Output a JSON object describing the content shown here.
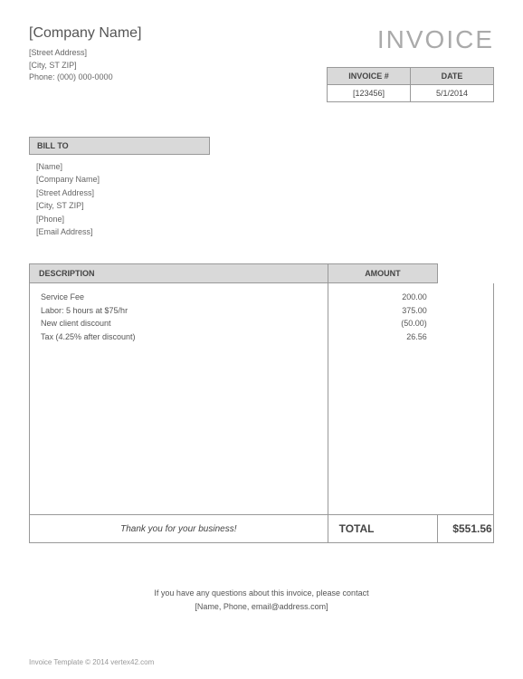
{
  "company": {
    "name": "[Company Name]",
    "street": "[Street Address]",
    "city_st_zip": "[City, ST  ZIP]",
    "phone_line": "Phone: (000) 000-0000"
  },
  "title": "INVOICE",
  "meta": {
    "invoice_num_label": "INVOICE #",
    "date_label": "DATE",
    "invoice_num": "[123456]",
    "date": "5/1/2014"
  },
  "billto": {
    "header": "BILL TO",
    "name": "[Name]",
    "company": "[Company Name]",
    "street": "[Street Address]",
    "city_st_zip": "[City, ST  ZIP]",
    "phone": "[Phone]",
    "email": "[Email Address]"
  },
  "columns": {
    "description": "DESCRIPTION",
    "amount": "AMOUNT"
  },
  "lines": [
    {
      "desc": "Service Fee",
      "amount": "200.00"
    },
    {
      "desc": "Labor: 5 hours at $75/hr",
      "amount": "375.00"
    },
    {
      "desc": "New client discount",
      "amount": "(50.00)"
    },
    {
      "desc": "Tax (4.25% after discount)",
      "amount": "26.56"
    }
  ],
  "thanks": "Thank you for your business!",
  "total_label": "TOTAL",
  "total_currency": "$",
  "total_amount": "551.56",
  "questions": {
    "line1": "If you have any questions about this invoice, please contact",
    "line2": "[Name, Phone, email@address.com]"
  },
  "footer_credit": "Invoice Template © 2014 vertex42.com"
}
